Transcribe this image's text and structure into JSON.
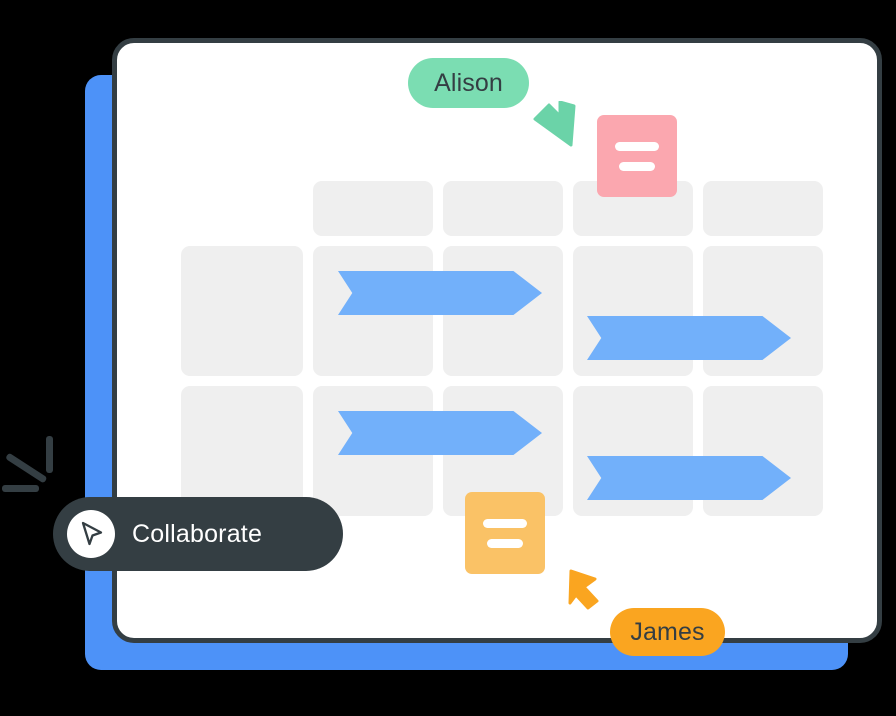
{
  "colors": {
    "backdrop_blue": "#4D92F8",
    "window_border": "#343E43",
    "window_bg": "#FFFFFF",
    "card_gray": "#EFEFEF",
    "ribbon_blue": "#72B0FA",
    "note_pink": "#FBA7AF",
    "note_orange": "#FAC266",
    "badge_green": "#7BDDB2",
    "badge_orange": "#FAA520",
    "pill_dark": "#343E43",
    "text_dark": "#343E43",
    "text_light": "#FFFFFF",
    "page_bg": "#000000"
  },
  "window": {
    "name": "collaboration-board-window"
  },
  "board": {
    "header_row": {
      "cards": [
        {
          "id": "header-card-1"
        },
        {
          "id": "header-card-2"
        },
        {
          "id": "header-card-3"
        },
        {
          "id": "header-card-4"
        }
      ]
    },
    "rows": [
      {
        "id": "board-row-1",
        "cards": [
          {
            "id": "row1-card-1"
          },
          {
            "id": "row1-card-2"
          },
          {
            "id": "row1-card-3"
          },
          {
            "id": "row1-card-4"
          },
          {
            "id": "row1-card-5"
          }
        ],
        "bars": [
          {
            "id": "row1-bar-1"
          },
          {
            "id": "row1-bar-2"
          }
        ]
      },
      {
        "id": "board-row-2",
        "cards": [
          {
            "id": "row2-card-1"
          },
          {
            "id": "row2-card-2"
          },
          {
            "id": "row2-card-3"
          },
          {
            "id": "row2-card-4"
          },
          {
            "id": "row2-card-5"
          }
        ],
        "bars": [
          {
            "id": "row2-bar-1"
          },
          {
            "id": "row2-bar-2"
          }
        ]
      }
    ]
  },
  "notes": [
    {
      "id": "pink-note",
      "color": "#FBA7AF",
      "lines": 2
    },
    {
      "id": "orange-note",
      "color": "#FAC266",
      "lines": 2
    }
  ],
  "collaborators": [
    {
      "id": "alison",
      "name": "Alison",
      "badge_color": "#7BDDB2",
      "cursor_color": "#6BD3A8",
      "cursor_direction": "down-right"
    },
    {
      "id": "james",
      "name": "James",
      "badge_color": "#FAA520",
      "cursor_color": "#FAA520",
      "cursor_direction": "up-left"
    }
  ],
  "collaborate_pill": {
    "label": "Collaborate",
    "icon": "cursor-arrow-icon",
    "background": "#343E43"
  }
}
